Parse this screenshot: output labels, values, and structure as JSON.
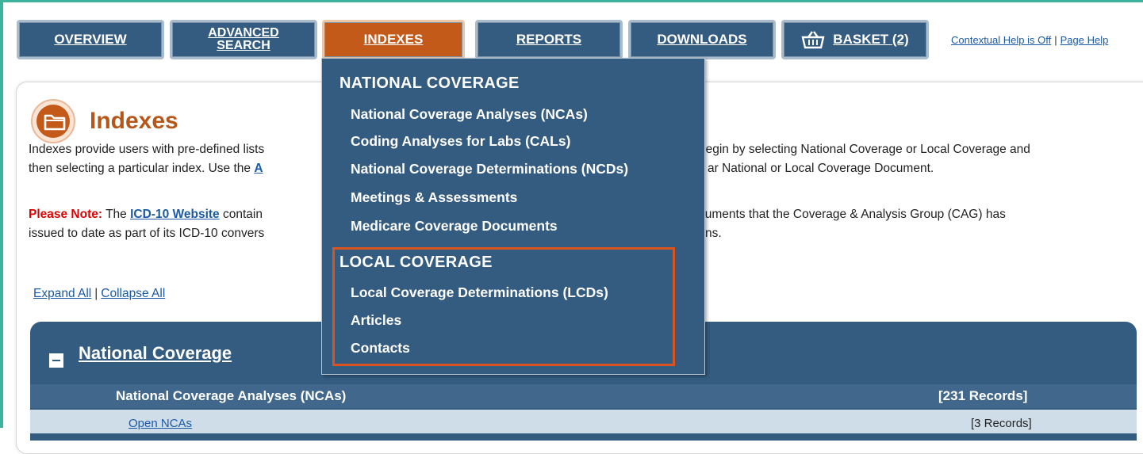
{
  "nav": {
    "tabs": [
      {
        "label": "OVERVIEW"
      },
      {
        "label_line1": "ADVANCED",
        "label_line2": "SEARCH"
      },
      {
        "label": "INDEXES"
      },
      {
        "label": "REPORTS"
      },
      {
        "label": "DOWNLOADS"
      },
      {
        "label": "BASKET (2)",
        "icon": "basket-icon"
      }
    ],
    "contextual_help": "Contextual Help is Off",
    "page_help": "Page Help",
    "separator": "|"
  },
  "page": {
    "title": "Indexes",
    "icon": "folder-icon",
    "intro_line1_a": "Indexes provide users with pre-defined lists",
    "intro_line1_b": "begin by selecting National Coverage or Local Coverage and",
    "intro_line2_a": "then selecting a particular index. Use the",
    "intro_line2_link": "A",
    "intro_line2_b": "ar National or Local Coverage Document.",
    "note_label": "Please Note:",
    "note_the": "The",
    "note_link": "ICD-10 Website",
    "note_line1_a": "contain",
    "note_line1_b": "cuments that the Coverage & Analysis Group (CAG) has",
    "note_line2_a": "issued to date as part of its ICD-10 convers",
    "note_line2_b": "ns.",
    "expand_all": "Expand All",
    "collapse_all": "Collapse All"
  },
  "national_panel": {
    "title": "National Coverage",
    "header_left": "National Coverage Analyses (NCAs)",
    "header_right": "[231 Records]",
    "row1_left": "Open NCAs",
    "row1_right": "[3 Records]"
  },
  "dropdown": {
    "national_heading": "NATIONAL COVERAGE",
    "national_items": [
      "National Coverage Analyses (NCAs)",
      "Coding Analyses for Labs (CALs)",
      "National Coverage Determinations (NCDs)",
      "Meetings & Assessments",
      "Medicare Coverage Documents"
    ],
    "local_heading": "LOCAL COVERAGE",
    "local_items": [
      "Local Coverage Determinations (LCDs)",
      "Articles",
      "Contacts"
    ]
  },
  "colors": {
    "nav_blue": "#345b80",
    "active_orange": "#c45a1a",
    "highlight_border": "#d9541e",
    "frame_green": "#3db39e"
  }
}
